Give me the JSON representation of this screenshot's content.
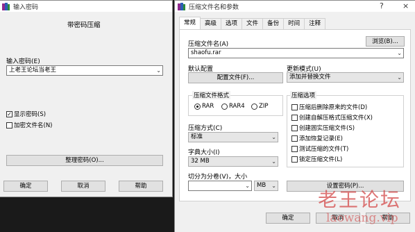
{
  "left_dialog": {
    "title": "输入密码",
    "heading": "带密码压缩",
    "password_label": "输入密码(E)",
    "password_value": "上老王论坛当老王",
    "show_password": {
      "label": "显示密码(S)",
      "checked": true
    },
    "encrypt_names": {
      "label": "加密文件名(N)",
      "checked": false
    },
    "manage_button": "整理密码(O)...",
    "ok": "确定",
    "cancel": "取消",
    "help": "帮助"
  },
  "right_dialog": {
    "title": "压缩文件名和参数",
    "help_glyph": "?",
    "close_glyph": "×",
    "tabs": [
      "常规",
      "高级",
      "选项",
      "文件",
      "备份",
      "时间",
      "注释"
    ],
    "archive_name_label": "压缩文件名(A)",
    "browse_button": "浏览(B)...",
    "archive_name_value": "shaofu.rar",
    "default_profile_label": "默认配置",
    "profile_button": "配置文件(F)...",
    "update_mode_label": "更新模式(U)",
    "update_mode_value": "添加并替换文件",
    "format_group": "压缩文件格式",
    "formats": [
      {
        "label": "RAR",
        "selected": true
      },
      {
        "label": "RAR4",
        "selected": false
      },
      {
        "label": "ZIP",
        "selected": false
      }
    ],
    "method_label": "压缩方式(C)",
    "method_value": "标准",
    "dict_label": "字典大小(I)",
    "dict_value": "32 MB",
    "split_label": "切分为分卷(V)，大小",
    "split_value": "",
    "split_unit": "MB",
    "options_group": "压缩选项",
    "options": [
      {
        "label": "压缩后删除原来的文件(D)",
        "checked": false
      },
      {
        "label": "创建自解压格式压缩文件(X)",
        "checked": false
      },
      {
        "label": "创建固实压缩文件(S)",
        "checked": false
      },
      {
        "label": "添加恢复记录(E)",
        "checked": false
      },
      {
        "label": "测试压缩的文件(T)",
        "checked": false
      },
      {
        "label": "锁定压缩文件(L)",
        "checked": false
      }
    ],
    "set_password_button": "设置密码(P)...",
    "ok": "确定",
    "cancel": "取消",
    "help": "帮助"
  },
  "watermark": {
    "text": "老王论坛",
    "url": "laowang.vip"
  }
}
